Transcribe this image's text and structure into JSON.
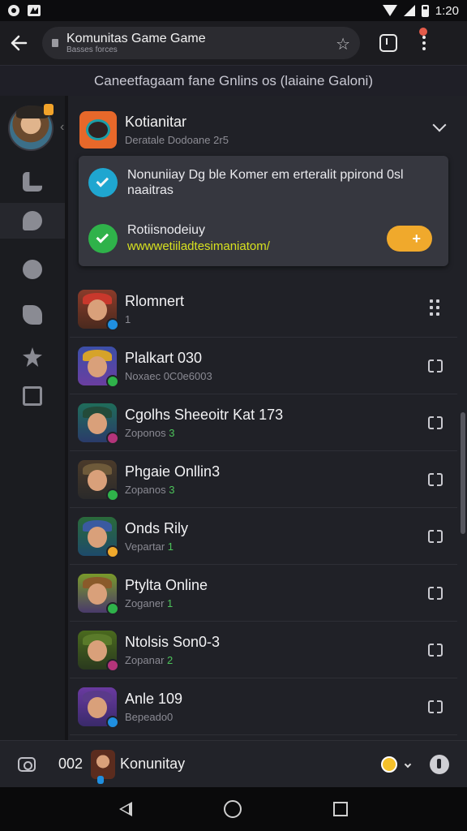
{
  "status_bar": {
    "time": "1:20",
    "icons": [
      "app-notification-icon",
      "gallery-notification-icon",
      "wifi-icon",
      "signal-icon",
      "battery-icon"
    ]
  },
  "browser": {
    "tab_title": "Komunitas Game Game",
    "url_subtitle": "Basses forces",
    "icons": [
      "back-arrow-icon",
      "lock-icon",
      "star-icon",
      "tabs-icon",
      "menu-icon"
    ]
  },
  "banner": {
    "text": "Caneetfagaam fane Gnlins os (laiaine Galoni)"
  },
  "sidebar": {
    "items": [
      {
        "name": "library",
        "icon": "library-icon"
      },
      {
        "name": "chat",
        "icon": "chat-icon"
      },
      {
        "name": "favorites",
        "icon": "heart-icon"
      },
      {
        "name": "plugins",
        "icon": "puzzle-icon"
      },
      {
        "name": "achievements",
        "icon": "star-badge-icon"
      },
      {
        "name": "news",
        "icon": "news-icon"
      }
    ]
  },
  "community_card": {
    "title": "Kotianitar",
    "subtitle": "Deratale Dodoane 2r5"
  },
  "popup": {
    "message": "Nonuniiay Dg ble Komer em erteralit ppirond 0sl naaitras",
    "notice_title": "Rotiisnodeiuy",
    "link": "wwwwetiiladtesimaniatom/",
    "toggle_symbol": "+"
  },
  "games": [
    {
      "name": "Rlomnert",
      "sub_label": "",
      "sub_value": "1",
      "action": "grid"
    },
    {
      "name": "Plalkart 030",
      "sub_label": "Noxaec 0C",
      "sub_value": "0e6003",
      "action": "open"
    },
    {
      "name": "Cgolhs Sheeoitr Kat 173",
      "sub_label": "Zoponos",
      "sub_value": "3",
      "action": "open"
    },
    {
      "name": "Phgaie Onllin3",
      "sub_label": "Zopanos",
      "sub_value": "3",
      "action": "open"
    },
    {
      "name": "Onds Rily",
      "sub_label": "Vepartar",
      "sub_value": "1",
      "action": "open"
    },
    {
      "name": "Ptylta Online",
      "sub_label": "Zoganer",
      "sub_value": "1",
      "action": "open"
    },
    {
      "name": "Ntolsis Son0-3",
      "sub_label": "Zopanar",
      "sub_value": "2",
      "action": "open"
    },
    {
      "name": "Anle 109",
      "sub_label": "Bepeado0",
      "sub_value": "",
      "action": "open"
    }
  ],
  "bottom_bar": {
    "count": "002",
    "community_name": "Konunitay"
  },
  "colors": {
    "accent_orange": "#e7682a",
    "check_blue": "#1fa6d0",
    "check_green": "#2fb24a",
    "link_yellow": "#d7e11f",
    "toggle_amber": "#f0a92c"
  }
}
